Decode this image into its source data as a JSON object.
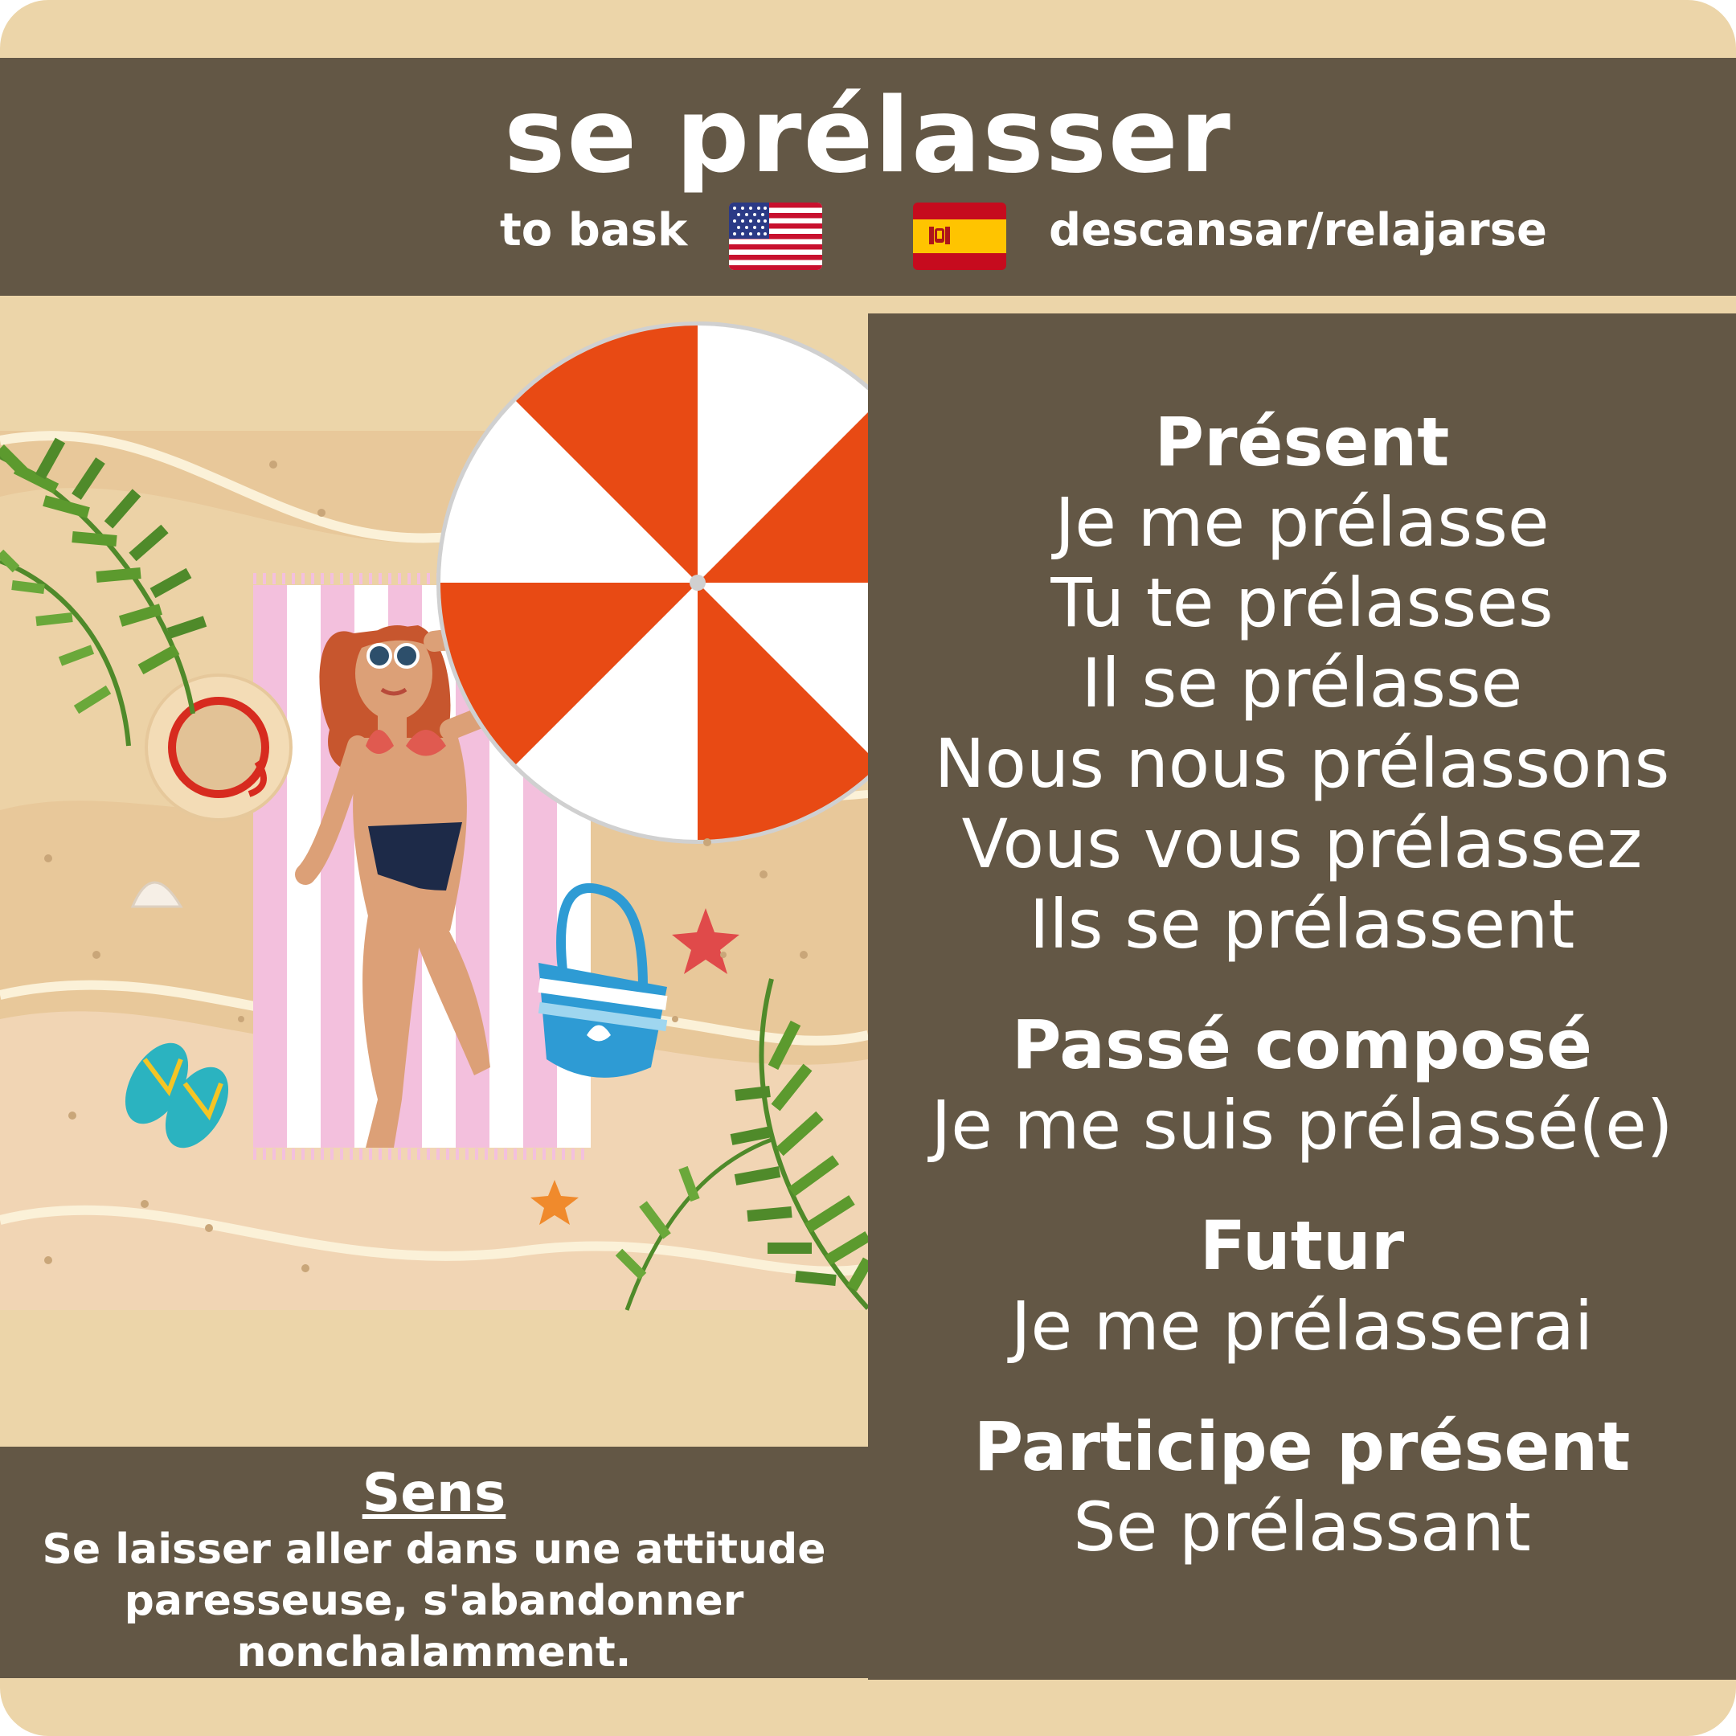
{
  "header": {
    "title": "se prélasser",
    "english": "to bask",
    "spanish": "descansar/relajarse"
  },
  "icons": {
    "flag_english": "us-flag-icon",
    "flag_spanish": "spain-flag-icon"
  },
  "colors": {
    "background": "#ecd5a9",
    "panel": "#635745",
    "text": "#ffffff",
    "umbrella_red": "#e84a14",
    "towel_pink": "#f3c0dd"
  },
  "conjugation": {
    "present": {
      "title": "Présent",
      "forms": [
        "Je me prélasse",
        "Tu te prélasses",
        "Il se prélasse",
        "Nous nous prélassons",
        "Vous vous prélassez",
        "Ils se prélassent"
      ]
    },
    "passe_compose": {
      "title": "Passé composé",
      "form": "Je me suis prélassé(e)"
    },
    "futur": {
      "title": "Futur",
      "form": "Je me prélasserai"
    },
    "participe_present": {
      "title": "Participe présent",
      "form": "Se prélassant"
    }
  },
  "sens": {
    "title": "Sens",
    "text": "Se laisser aller dans une attitude paresseuse, s'abandonner nonchalamment."
  }
}
